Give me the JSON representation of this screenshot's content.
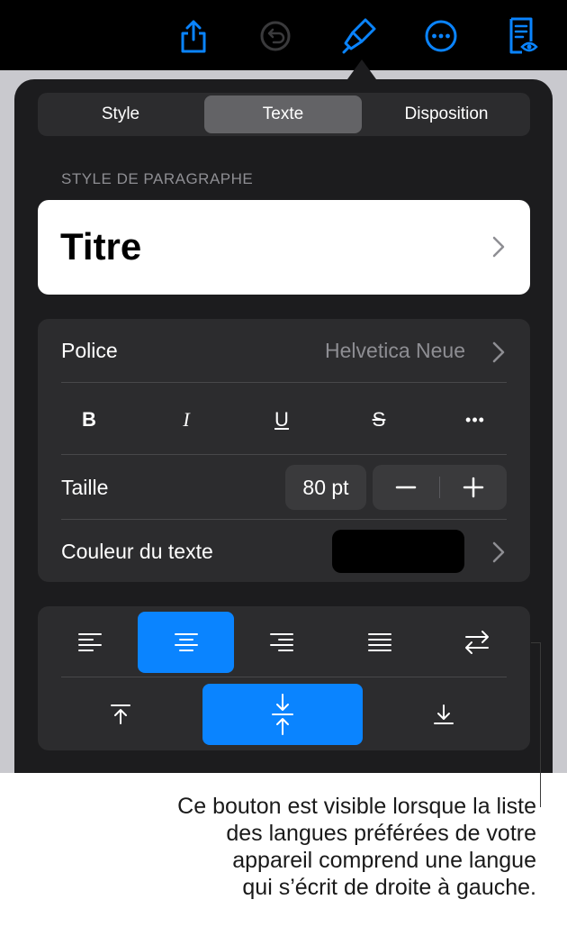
{
  "toolbar": {
    "icons": [
      "share-icon",
      "undo-icon",
      "format-brush-icon",
      "more-icon",
      "reader-view-icon"
    ],
    "accent": "#0a84ff"
  },
  "tabs": {
    "style": "Style",
    "text": "Texte",
    "layout": "Disposition",
    "active": "Texte"
  },
  "paragraph": {
    "section_label": "STYLE DE PARAGRAPHE",
    "current": "Titre"
  },
  "font": {
    "label": "Police",
    "value": "Helvetica Neue",
    "format_buttons": {
      "bold": "B",
      "italic": "I",
      "underline": "U",
      "strike": "S",
      "more": "•••"
    }
  },
  "size": {
    "label": "Taille",
    "value": "80 pt",
    "decrement": "−",
    "increment": "+"
  },
  "color": {
    "label": "Couleur du texte",
    "value": "#000000"
  },
  "alignment": {
    "horizontal": [
      "align-left-icon",
      "align-center-icon",
      "align-right-icon",
      "justify-icon",
      "text-direction-icon"
    ],
    "horizontal_active": "align-center-icon",
    "vertical": [
      "align-top-icon",
      "align-middle-icon",
      "align-bottom-icon"
    ],
    "vertical_active": "align-middle-icon"
  },
  "callout": {
    "lines": [
      "Ce bouton est visible lorsque la liste",
      "des langues préférées de votre",
      "appareil comprend une langue",
      "qui s’écrit de droite à gauche."
    ]
  }
}
